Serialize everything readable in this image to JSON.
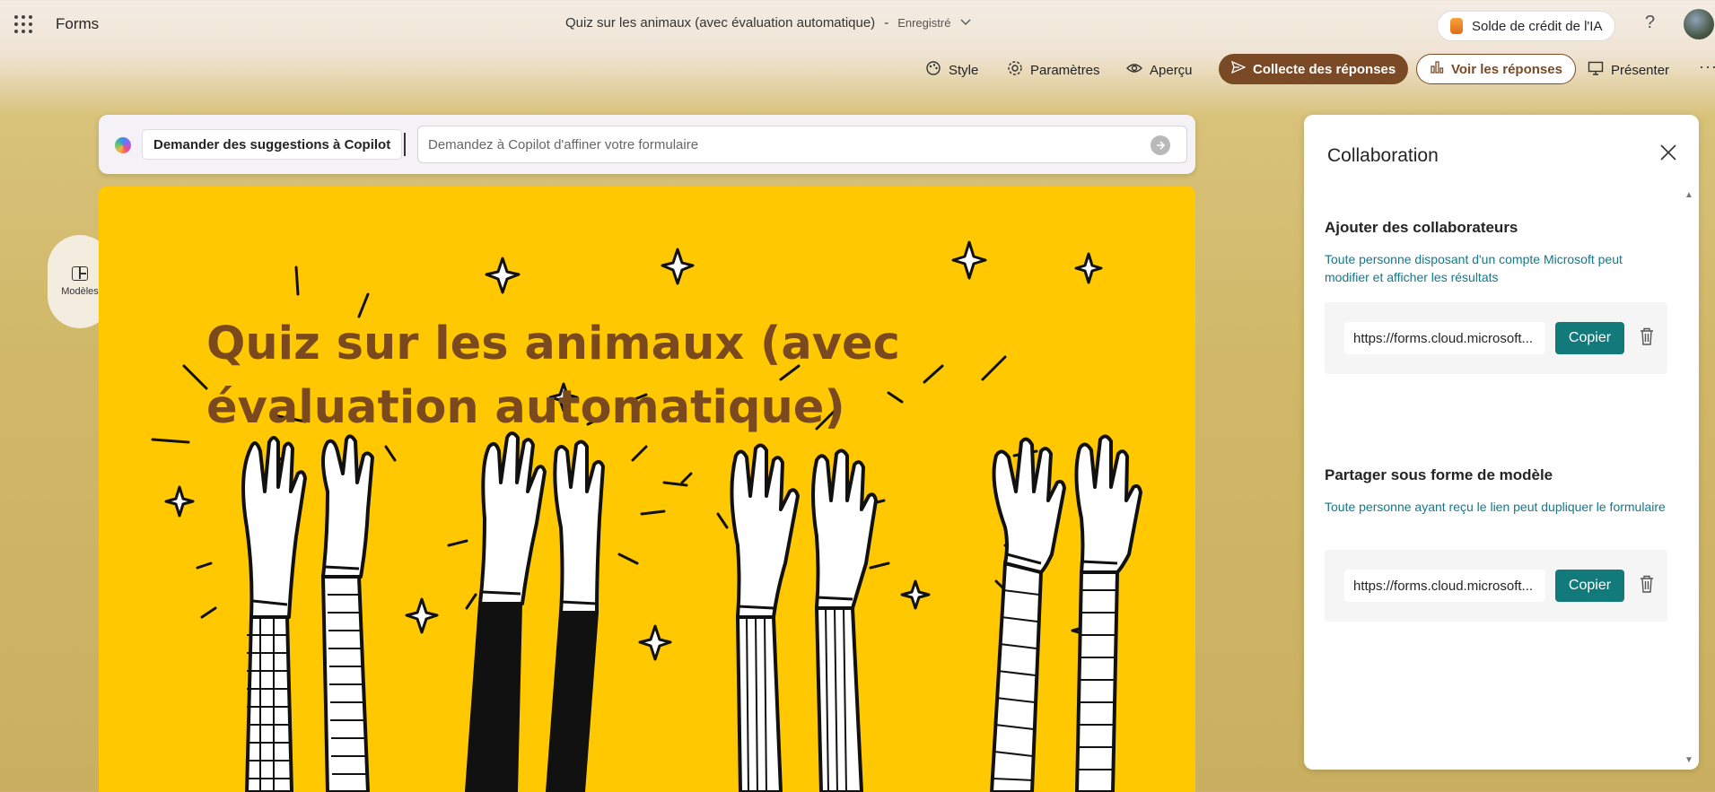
{
  "header": {
    "app_name": "Forms",
    "doc_title": "Quiz sur les animaux (avec évaluation automatique)",
    "separator": "-",
    "save_status": "Enregistré",
    "credit_button": "Solde de crédit de l'IA",
    "help": "?"
  },
  "toolbar": {
    "style": "Style",
    "settings": "Paramètres",
    "preview": "Aperçu",
    "collect": "Collecte des réponses",
    "view_responses": "Voir les réponses",
    "present": "Présenter",
    "more": "···"
  },
  "copilot": {
    "suggest_label": "Demander des suggestions à Copilot",
    "placeholder": "Demandez à Copilot d'affiner votre formulaire"
  },
  "sidebar": {
    "templates_label": "Modèles"
  },
  "form": {
    "title": "Quiz sur les animaux (avec évaluation automatique)"
  },
  "panel": {
    "title": "Collaboration",
    "collaborators": {
      "heading": "Ajouter des collaborateurs",
      "description": "Toute personne disposant d'un compte Microsoft peut modifier et afficher les résultats",
      "link": "https://forms.cloud.microsoft...",
      "copy_label": "Copier"
    },
    "template_share": {
      "heading": "Partager sous forme de modèle",
      "description": "Toute personne ayant reçu le lien peut dupliquer le formulaire",
      "link": "https://forms.cloud.microsoft...",
      "copy_label": "Copier"
    }
  },
  "colors": {
    "accent_brown": "#7a4a26",
    "hero_yellow": "#ffc800",
    "title_brown": "#7a4a1e",
    "teal": "#127a7a",
    "link_text": "#14788a"
  }
}
